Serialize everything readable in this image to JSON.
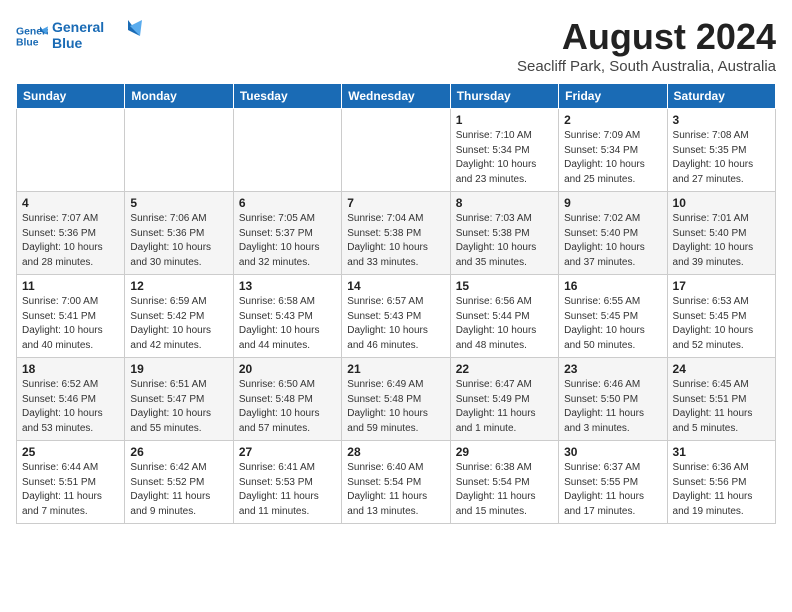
{
  "logo": {
    "line1": "General",
    "line2": "Blue"
  },
  "title": "August 2024",
  "subtitle": "Seacliff Park, South Australia, Australia",
  "weekdays": [
    "Sunday",
    "Monday",
    "Tuesday",
    "Wednesday",
    "Thursday",
    "Friday",
    "Saturday"
  ],
  "weeks": [
    [
      {
        "day": "",
        "info": ""
      },
      {
        "day": "",
        "info": ""
      },
      {
        "day": "",
        "info": ""
      },
      {
        "day": "",
        "info": ""
      },
      {
        "day": "1",
        "info": "Sunrise: 7:10 AM\nSunset: 5:34 PM\nDaylight: 10 hours\nand 23 minutes."
      },
      {
        "day": "2",
        "info": "Sunrise: 7:09 AM\nSunset: 5:34 PM\nDaylight: 10 hours\nand 25 minutes."
      },
      {
        "day": "3",
        "info": "Sunrise: 7:08 AM\nSunset: 5:35 PM\nDaylight: 10 hours\nand 27 minutes."
      }
    ],
    [
      {
        "day": "4",
        "info": "Sunrise: 7:07 AM\nSunset: 5:36 PM\nDaylight: 10 hours\nand 28 minutes."
      },
      {
        "day": "5",
        "info": "Sunrise: 7:06 AM\nSunset: 5:36 PM\nDaylight: 10 hours\nand 30 minutes."
      },
      {
        "day": "6",
        "info": "Sunrise: 7:05 AM\nSunset: 5:37 PM\nDaylight: 10 hours\nand 32 minutes."
      },
      {
        "day": "7",
        "info": "Sunrise: 7:04 AM\nSunset: 5:38 PM\nDaylight: 10 hours\nand 33 minutes."
      },
      {
        "day": "8",
        "info": "Sunrise: 7:03 AM\nSunset: 5:38 PM\nDaylight: 10 hours\nand 35 minutes."
      },
      {
        "day": "9",
        "info": "Sunrise: 7:02 AM\nSunset: 5:40 PM\nDaylight: 10 hours\nand 37 minutes."
      },
      {
        "day": "10",
        "info": "Sunrise: 7:01 AM\nSunset: 5:40 PM\nDaylight: 10 hours\nand 39 minutes."
      }
    ],
    [
      {
        "day": "11",
        "info": "Sunrise: 7:00 AM\nSunset: 5:41 PM\nDaylight: 10 hours\nand 40 minutes."
      },
      {
        "day": "12",
        "info": "Sunrise: 6:59 AM\nSunset: 5:42 PM\nDaylight: 10 hours\nand 42 minutes."
      },
      {
        "day": "13",
        "info": "Sunrise: 6:58 AM\nSunset: 5:43 PM\nDaylight: 10 hours\nand 44 minutes."
      },
      {
        "day": "14",
        "info": "Sunrise: 6:57 AM\nSunset: 5:43 PM\nDaylight: 10 hours\nand 46 minutes."
      },
      {
        "day": "15",
        "info": "Sunrise: 6:56 AM\nSunset: 5:44 PM\nDaylight: 10 hours\nand 48 minutes."
      },
      {
        "day": "16",
        "info": "Sunrise: 6:55 AM\nSunset: 5:45 PM\nDaylight: 10 hours\nand 50 minutes."
      },
      {
        "day": "17",
        "info": "Sunrise: 6:53 AM\nSunset: 5:45 PM\nDaylight: 10 hours\nand 52 minutes."
      }
    ],
    [
      {
        "day": "18",
        "info": "Sunrise: 6:52 AM\nSunset: 5:46 PM\nDaylight: 10 hours\nand 53 minutes."
      },
      {
        "day": "19",
        "info": "Sunrise: 6:51 AM\nSunset: 5:47 PM\nDaylight: 10 hours\nand 55 minutes."
      },
      {
        "day": "20",
        "info": "Sunrise: 6:50 AM\nSunset: 5:48 PM\nDaylight: 10 hours\nand 57 minutes."
      },
      {
        "day": "21",
        "info": "Sunrise: 6:49 AM\nSunset: 5:48 PM\nDaylight: 10 hours\nand 59 minutes."
      },
      {
        "day": "22",
        "info": "Sunrise: 6:47 AM\nSunset: 5:49 PM\nDaylight: 11 hours\nand 1 minute."
      },
      {
        "day": "23",
        "info": "Sunrise: 6:46 AM\nSunset: 5:50 PM\nDaylight: 11 hours\nand 3 minutes."
      },
      {
        "day": "24",
        "info": "Sunrise: 6:45 AM\nSunset: 5:51 PM\nDaylight: 11 hours\nand 5 minutes."
      }
    ],
    [
      {
        "day": "25",
        "info": "Sunrise: 6:44 AM\nSunset: 5:51 PM\nDaylight: 11 hours\nand 7 minutes."
      },
      {
        "day": "26",
        "info": "Sunrise: 6:42 AM\nSunset: 5:52 PM\nDaylight: 11 hours\nand 9 minutes."
      },
      {
        "day": "27",
        "info": "Sunrise: 6:41 AM\nSunset: 5:53 PM\nDaylight: 11 hours\nand 11 minutes."
      },
      {
        "day": "28",
        "info": "Sunrise: 6:40 AM\nSunset: 5:54 PM\nDaylight: 11 hours\nand 13 minutes."
      },
      {
        "day": "29",
        "info": "Sunrise: 6:38 AM\nSunset: 5:54 PM\nDaylight: 11 hours\nand 15 minutes."
      },
      {
        "day": "30",
        "info": "Sunrise: 6:37 AM\nSunset: 5:55 PM\nDaylight: 11 hours\nand 17 minutes."
      },
      {
        "day": "31",
        "info": "Sunrise: 6:36 AM\nSunset: 5:56 PM\nDaylight: 11 hours\nand 19 minutes."
      }
    ]
  ]
}
